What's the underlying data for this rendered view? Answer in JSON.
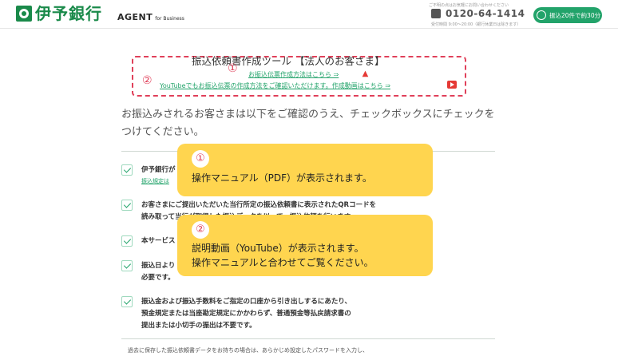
{
  "header": {
    "bank_name": "伊予銀行",
    "product": "AGENT",
    "product_sub": "for Business",
    "contact_note": "ご不明の点はお気軽にお問い合わせください",
    "phone": "0120-64-1414",
    "hours": "受付時間 9:00～20:00（銀行休業日は除きます）",
    "promo": "振込20件で約30分"
  },
  "tool": {
    "title": "振込依頼書作成ツール 【法人のお客さま】",
    "marker1": "①",
    "marker2": "②",
    "link_manual": "お振込伝票作成方法はこちら ⇒",
    "link_video": "YouTubeでもお振込伝票の作成方法をご確認いただけます。作成動画はこちら ⇒"
  },
  "intro": "お振込みされるお客さまは以下をご確認のうえ、チェックボックスにチェックをつけてください。",
  "checklist": [
    {
      "line1": "伊予銀行が",
      "link": "振込規定は"
    },
    {
      "line1": "お客さまにご提出いただいた当行所定の振込依頼書に表示されたQRコードを",
      "line2": "読み取って当行が取得した振込データを以って、振込依頼を行います。"
    },
    {
      "line1": "本サービス"
    },
    {
      "line1": "振込日より",
      "line2": "必要です。"
    },
    {
      "line1": "振込金および振込手数料をご指定の口座から引き出しするにあたり、",
      "line2": "預金規定または当座勘定規定にかかわらず、普通預金等払戻請求書の",
      "line3": "提出または小切手の振出は不要です。"
    }
  ],
  "callouts": [
    {
      "badge": "①",
      "text": "操作マニュアル（PDF）が表示されます。"
    },
    {
      "badge": "②",
      "line1": "説明動画（YouTube）が表示されます。",
      "line2": "操作マニュアルと合わせてご覧ください。"
    }
  ],
  "footer_note": "過去に保存した振込依頼書データをお持ちの場合は、あらかじめ設定したパスワードを入力し、",
  "colors": {
    "brand_green": "#1a8a4a",
    "accent_green": "#22a36a",
    "marker_red": "#e0405a",
    "callout_yellow": "#ffd54f"
  },
  "icons": [
    "phone-icon",
    "clock-icon",
    "pdf-icon",
    "youtube-icon",
    "checkbox-checked-icon"
  ]
}
